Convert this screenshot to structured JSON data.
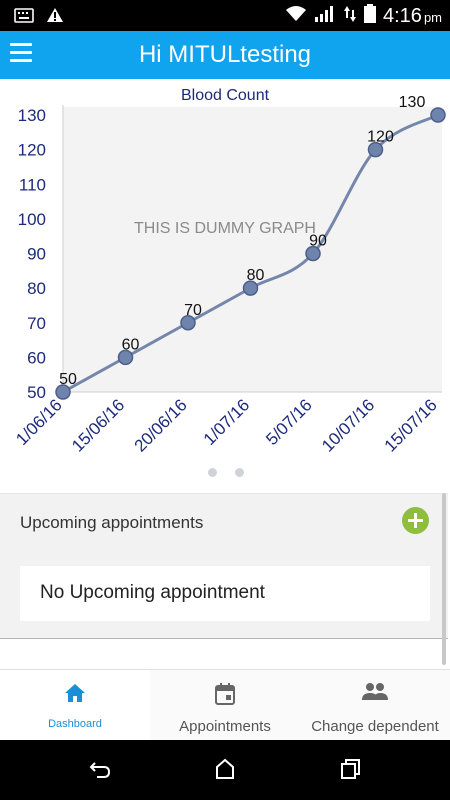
{
  "status_bar": {
    "time": "4:16",
    "ampm": "pm",
    "icons": [
      "keyboard-icon",
      "warning-icon",
      "wifi-icon",
      "signal-icon",
      "data-icon",
      "battery-icon"
    ]
  },
  "app_bar": {
    "title": "Hi MITULtesting",
    "menu_icon": "hamburger-icon"
  },
  "chart_data": {
    "type": "line",
    "title": "Blood Count",
    "watermark": "THIS IS DUMMY GRAPH",
    "categories": [
      "1/06/16",
      "15/06/16",
      "20/06/16",
      "1/07/16",
      "5/07/16",
      "10/07/16",
      "15/07/16"
    ],
    "values": [
      50,
      60,
      70,
      80,
      90,
      120,
      130
    ],
    "yticks": [
      50,
      60,
      70,
      80,
      90,
      100,
      110,
      120,
      130
    ],
    "ylim": [
      50,
      130
    ],
    "line_color": "#7487ab",
    "point_color": "#6f84ad",
    "axis_text_color": "#1d2a7a"
  },
  "appointments": {
    "section_title": "Upcoming appointments",
    "add_icon": "plus-circle-icon",
    "add_color": "#8fbd3e",
    "empty_message": "No Upcoming appointment"
  },
  "bottom_nav": {
    "items": [
      {
        "label": "Dashboard",
        "icon": "home-icon",
        "active": true
      },
      {
        "label": "Appointments",
        "icon": "calendar-icon",
        "active": false
      },
      {
        "label": "Change dependent",
        "icon": "people-icon",
        "active": false
      }
    ],
    "active_color": "#1a8fd6"
  },
  "system_nav": {
    "icons": [
      "back-icon",
      "home-nav-icon",
      "recents-icon"
    ]
  }
}
